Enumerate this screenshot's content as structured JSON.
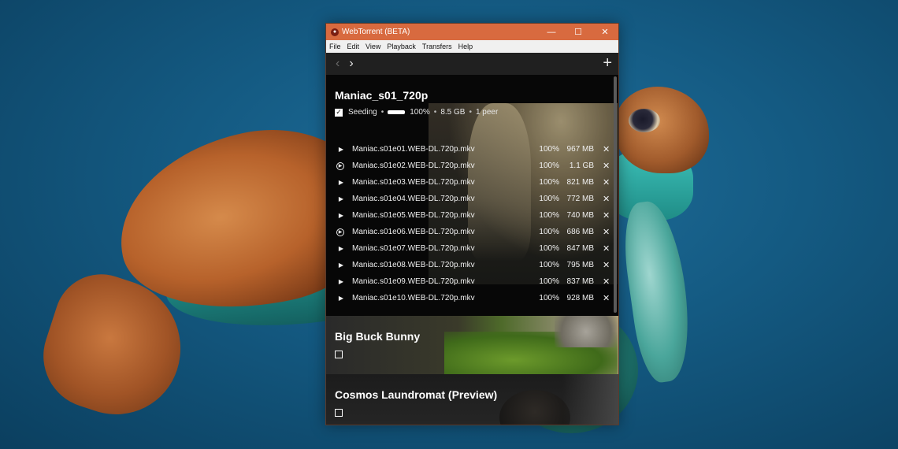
{
  "window": {
    "title": "WebTorrent (BETA)",
    "controls": {
      "minimize": "—",
      "maximize": "☐",
      "close": "✕"
    }
  },
  "menu": [
    "File",
    "Edit",
    "View",
    "Playback",
    "Transfers",
    "Help"
  ],
  "toolbar": {
    "back_icon": "‹",
    "forward_icon": "›",
    "add_icon": "+"
  },
  "torrents": [
    {
      "name": "Maniac_s01_720p",
      "status": "Seeding",
      "progress": "100%",
      "progress_fraction": 1.0,
      "size": "8.5 GB",
      "peers": "1 peer",
      "files": [
        {
          "name": "Maniac.s01e01.WEB-DL.720p.mkv",
          "percent": "100%",
          "size": "967 MB",
          "icon": "play-icon"
        },
        {
          "name": "Maniac.s01e02.WEB-DL.720p.mkv",
          "percent": "100%",
          "size": "1.1 GB",
          "icon": "play-circle-icon"
        },
        {
          "name": "Maniac.s01e03.WEB-DL.720p.mkv",
          "percent": "100%",
          "size": "821 MB",
          "icon": "play-icon"
        },
        {
          "name": "Maniac.s01e04.WEB-DL.720p.mkv",
          "percent": "100%",
          "size": "772 MB",
          "icon": "play-icon"
        },
        {
          "name": "Maniac.s01e05.WEB-DL.720p.mkv",
          "percent": "100%",
          "size": "740 MB",
          "icon": "play-icon"
        },
        {
          "name": "Maniac.s01e06.WEB-DL.720p.mkv",
          "percent": "100%",
          "size": "686 MB",
          "icon": "play-circle-icon"
        },
        {
          "name": "Maniac.s01e07.WEB-DL.720p.mkv",
          "percent": "100%",
          "size": "847 MB",
          "icon": "play-icon"
        },
        {
          "name": "Maniac.s01e08.WEB-DL.720p.mkv",
          "percent": "100%",
          "size": "795 MB",
          "icon": "play-icon"
        },
        {
          "name": "Maniac.s01e09.WEB-DL.720p.mkv",
          "percent": "100%",
          "size": "837 MB",
          "icon": "play-icon"
        },
        {
          "name": "Maniac.s01e10.WEB-DL.720p.mkv",
          "percent": "100%",
          "size": "928 MB",
          "icon": "play-icon"
        }
      ]
    },
    {
      "name": "Big Buck Bunny"
    },
    {
      "name": "Cosmos Laundromat (Preview)"
    }
  ],
  "colors": {
    "titlebar": "#d86a3f",
    "background": "#1a1a1a"
  }
}
